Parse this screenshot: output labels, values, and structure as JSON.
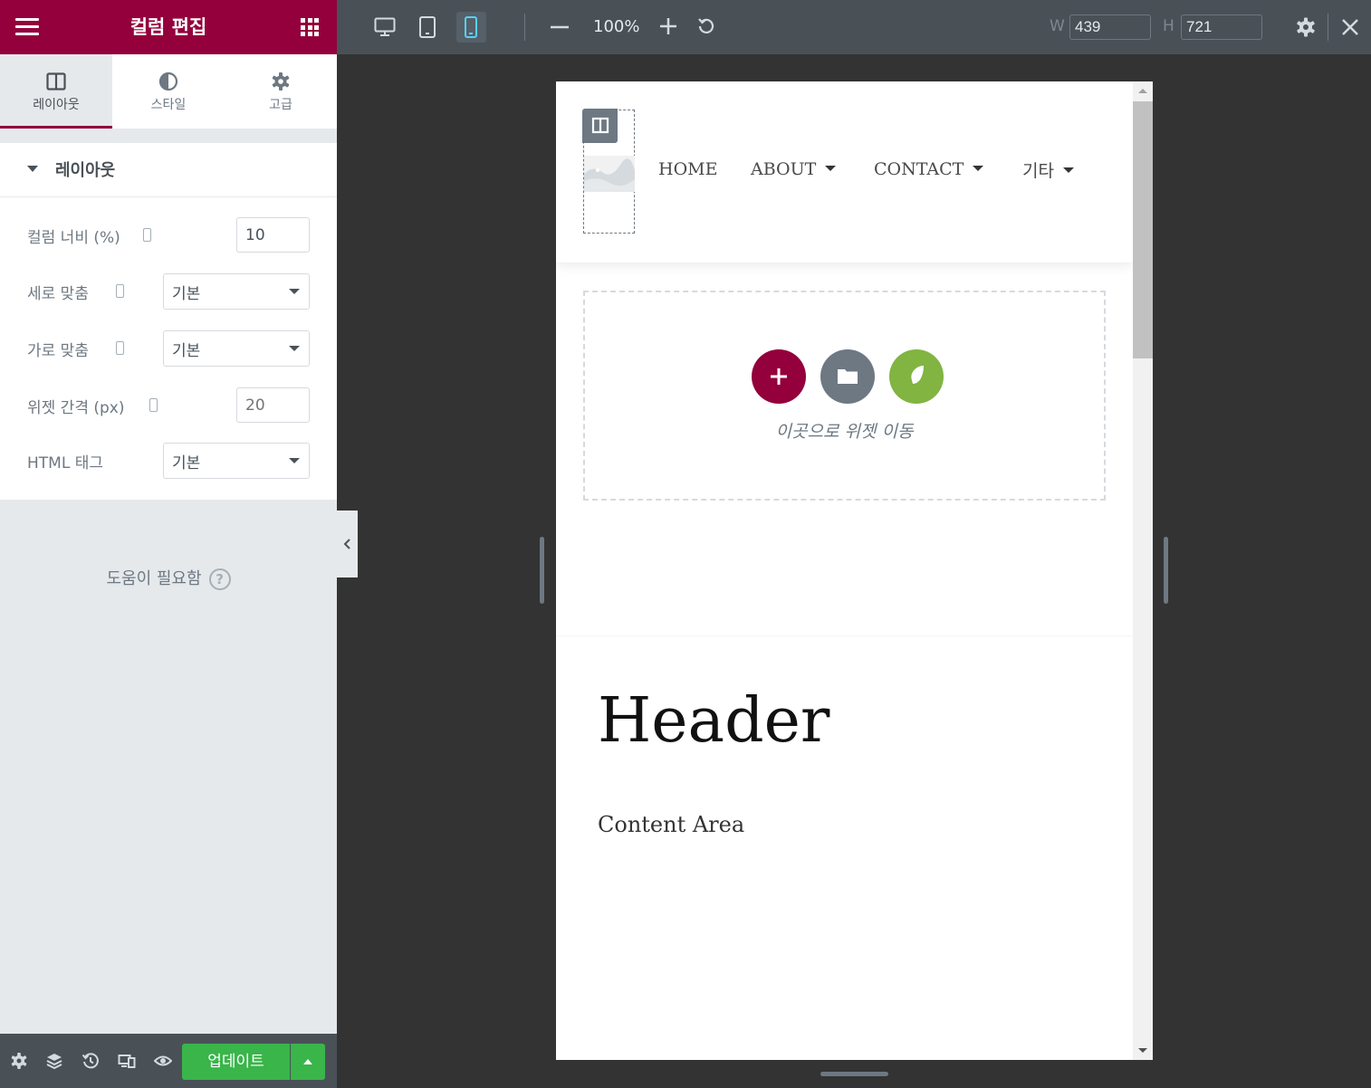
{
  "panel": {
    "title": "컬럼 편집",
    "tabs": [
      {
        "label": "레이아웃",
        "icon": "columns-icon",
        "active": true
      },
      {
        "label": "스타일",
        "icon": "contrast-icon",
        "active": false
      },
      {
        "label": "고급",
        "icon": "gear-icon",
        "active": false
      }
    ],
    "section_title": "레이아웃",
    "controls": {
      "column_width": {
        "label": "컬럼 너비 (%)",
        "value": "10"
      },
      "vertical_align": {
        "label": "세로 맞춤",
        "value": "기본"
      },
      "horizontal_align": {
        "label": "가로 맞춤",
        "value": "기본"
      },
      "widget_gap": {
        "label": "위젯 간격 (px)",
        "placeholder": "20"
      },
      "html_tag": {
        "label": "HTML 태그",
        "value": "기본"
      }
    },
    "help": {
      "label": "도움이 필요함",
      "icon": "question-circle-icon"
    },
    "footer": {
      "update_label": "업데이트",
      "icons": [
        "settings-icon",
        "layers-icon",
        "history-icon",
        "responsive-icon",
        "eye-icon"
      ]
    }
  },
  "topbar": {
    "devices": [
      "desktop-icon",
      "tablet-icon",
      "mobile-icon"
    ],
    "active_device": "mobile",
    "zoom": "100%",
    "width_label": "W",
    "width_value": "439",
    "height_label": "H",
    "height_value": "721"
  },
  "preview": {
    "nav_items": [
      {
        "label": "HOME",
        "dropdown": false
      },
      {
        "label": "ABOUT",
        "dropdown": true
      },
      {
        "label": "CONTACT",
        "dropdown": true
      },
      {
        "label": "기타",
        "dropdown": true
      }
    ],
    "drop_text": "이곳으로 위젯 이동",
    "header": "Header",
    "content": "Content Area"
  },
  "colors": {
    "brand": "#93003c",
    "update_green": "#39b54a",
    "envato_green": "#81b441",
    "toolbar": "#495157",
    "mobile_active": "#58d0f5"
  }
}
